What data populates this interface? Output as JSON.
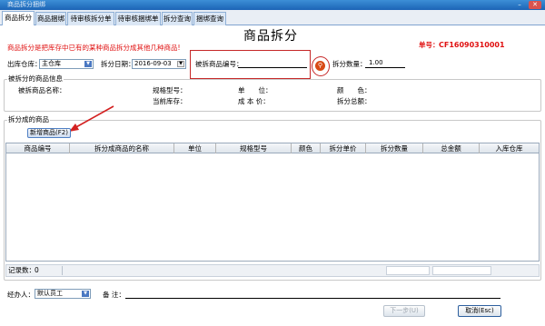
{
  "window": {
    "title": "商品拆分捆绑"
  },
  "tabs": [
    "商品拆分",
    "商品捆绑",
    "待审核拆分单",
    "待审核捆绑单",
    "拆分查询",
    "捆绑查询"
  ],
  "form": {
    "title": "商品拆分",
    "hint": "商品拆分是把库存中已有的某种商品拆分成其他几种商品!",
    "order_label": "单号：",
    "order_no": "CF16090310001",
    "warehouse_label": "出库仓库：",
    "warehouse_value": "主仓库",
    "date_label": "拆分日期：",
    "date_value": "2016-09-03",
    "item_code_label": "被拆商品编号：",
    "item_code_value": "",
    "qty_label": "拆分数量：",
    "qty_value": "1.00"
  },
  "info": {
    "legend": "被拆分的商品信息",
    "name_label": "被拆商品名称：",
    "spec_label": "规格型号：",
    "unit_label": "单　　位：",
    "color_label": "颜　　色：",
    "stock_label": "当前库存：",
    "cost_label": "成 本 价：",
    "total_label": "拆分总额："
  },
  "products": {
    "legend": "拆分成的商品",
    "add_button": "新增商品(F2)",
    "columns": [
      "商品编号",
      "拆分成商品的名称",
      "单位",
      "规格型号",
      "颜色",
      "拆分单价",
      "拆分数量",
      "总金额",
      "入库仓库"
    ],
    "record_label": "记录数：",
    "record_count": "0"
  },
  "footer": {
    "handler_label": "经办人：",
    "handler_value": "默认员工",
    "remark_label": "备 注：",
    "remark_value": "",
    "next_button": "下一步(U)",
    "cancel_button": "取消(Esc)"
  },
  "colors": {
    "accent": "#1c64b6",
    "red": "#e01010"
  }
}
